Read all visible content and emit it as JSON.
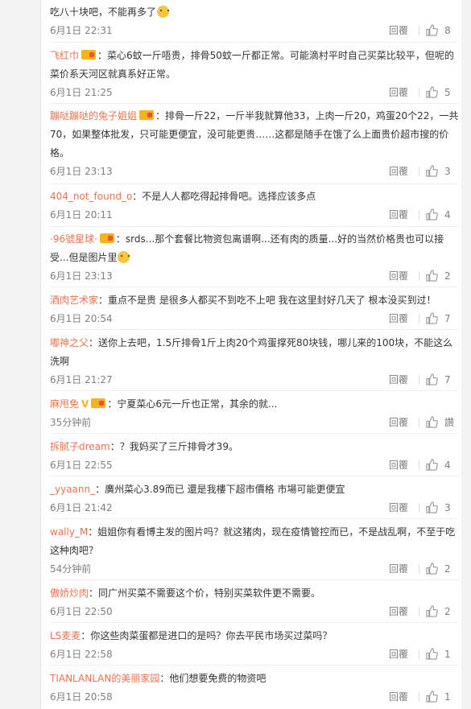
{
  "comments": [
    {
      "user": "",
      "text": "吃八十块吧，不能再多了",
      "time": "6月1日 22:31",
      "reply": "回覆",
      "likes": "8"
    },
    {
      "user": "飞红巾",
      "text": "：菜心6蚊一斤唔贵，排骨50蚊一斤都正常。可能滴村平时自己买菜比较平，但呢的菜价系天河区就真系好正常。",
      "time": "6月1日 21:25",
      "reply": "回覆",
      "likes": "5"
    },
    {
      "user": "蹦哒蹦哒的兔子姐姐",
      "text": "：排骨一斤22，一斤半我就算他33，上肉一斤20，鸡蛋20个22，一共70，如果整体批发，只可能更便宜，没可能更贵……这都是随手在饿了么上面贵价超市搜的价格。",
      "time": "6月1日 23:13",
      "reply": "回覆",
      "likes": "3"
    },
    {
      "user": "404_not_found_o",
      "text": "：不是人人都吃得起排骨吧。选择应该多点",
      "time": "6月1日 20:11",
      "reply": "回覆",
      "likes": "4"
    },
    {
      "user": "·96號星球·",
      "text": "：srds...那个套餐比物资包离谱啊...还有肉的质量...好的当然价格贵也可以接受...但是图片里",
      "time": "6月1日 23:13",
      "reply": "回覆",
      "likes": "2"
    },
    {
      "user": "酒肉艺术家",
      "text": "：重点不是贵 是很多人都买不到吃不上吧 我在这里封好几天了 根本没买到过！",
      "time": "6月1日 20:54",
      "reply": "回覆",
      "likes": "7"
    },
    {
      "user": "嘟神之父",
      "text": "：送你上去吧，1.5斤排骨1斤上肉20个鸡蛋撑死80块钱，哪儿来的100块，不能这么洗啊",
      "time": "6月1日 21:27",
      "reply": "回覆",
      "likes": "7"
    },
    {
      "user": "麻甩免",
      "text": "：宁夏菜心6元一斤也正常，其余的就...",
      "time": "35分钟前",
      "reply": "回覆",
      "likes": "讚"
    },
    {
      "user": "拆腻子dream",
      "text": "：？我妈买了三斤排骨才39。",
      "time": "6月1日 22:55",
      "reply": "回覆",
      "likes": "4"
    },
    {
      "user": "_yyaann_",
      "text": "：廣州菜心3.89而已 還是我樓下超市價格 市場可能更便宜",
      "time": "6月1日 21:42",
      "reply": "回覆",
      "likes": "3"
    },
    {
      "user": "wally_M",
      "text": "：姐姐你有看博主发的图片吗？就这猪肉，现在疫情管控而已，不是战乱啊，不至于吃这种肉吧？",
      "time": "54分钟前",
      "reply": "回覆",
      "likes": "2"
    },
    {
      "user": "傲娇炒肉",
      "text": "：同广州买菜不需要这个价，特别买菜软件更不需要。",
      "time": "6月1日 22:50",
      "reply": "回覆",
      "likes": "2"
    },
    {
      "user": "LS麦麦",
      "text": "：你这些肉菜蛋都是进口的是吗？你去平民市场买过菜吗？",
      "time": "6月1日 22:58",
      "reply": "回覆",
      "likes": "1"
    },
    {
      "user": "TIANLANLAN的美丽家园",
      "text": "：他们想要免费的物资吧",
      "time": "6月1日 20:58",
      "reply": "回覆",
      "likes": "1"
    }
  ],
  "icons": {
    "like": "thumbs-up-icon",
    "emoji": "emoji-icon",
    "badge": "fan-badge-icon"
  },
  "colors": {
    "username": "#eb7350",
    "meta": "#808080",
    "text": "#333333"
  }
}
